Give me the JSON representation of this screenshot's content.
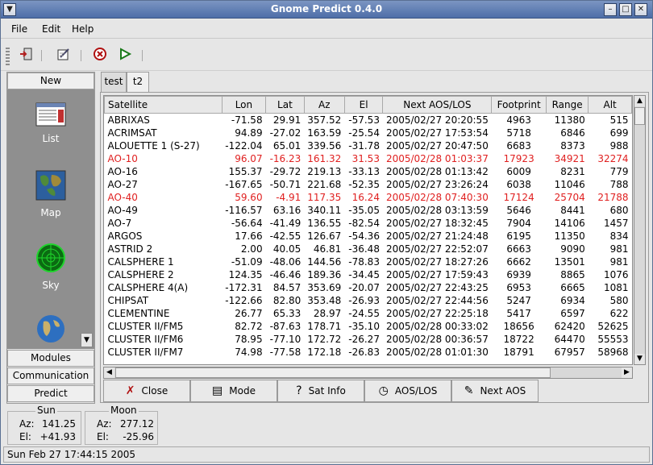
{
  "window": {
    "title": "Gnome Predict 0.4.0"
  },
  "menu": {
    "file": "File",
    "edit": "Edit",
    "help": "Help"
  },
  "shortcut": {
    "group_top": "New",
    "items": [
      {
        "label": "List",
        "icon": "list-icon"
      },
      {
        "label": "Map",
        "icon": "map-icon"
      },
      {
        "label": "Sky",
        "icon": "radar-icon"
      },
      {
        "label": "",
        "icon": "globe-icon"
      }
    ],
    "groups_bottom": [
      "Modules",
      "Communication",
      "Predict"
    ]
  },
  "tabs": [
    "test",
    "t2"
  ],
  "active_tab": "t2",
  "table": {
    "columns": [
      "Satellite",
      "Lon",
      "Lat",
      "Az",
      "El",
      "Next AOS/LOS",
      "Footprint",
      "Range",
      "Alt"
    ],
    "rows": [
      [
        "ABRIXAS",
        "-71.58",
        "29.91",
        "357.52",
        "-57.53",
        "2005/02/27 20:20:55",
        "4963",
        "11380",
        "515"
      ],
      [
        "ACRIMSAT",
        "94.89",
        "-27.02",
        "163.59",
        "-25.54",
        "2005/02/27 17:53:54",
        "5718",
        "6846",
        "699"
      ],
      [
        "ALOUETTE 1 (S-27)",
        "-122.04",
        "65.01",
        "339.56",
        "-31.78",
        "2005/02/27 20:47:50",
        "6683",
        "8373",
        "988"
      ],
      [
        "AO-10",
        "96.07",
        "-16.23",
        "161.32",
        "31.53",
        "2005/02/28 01:03:37",
        "17923",
        "34921",
        "32274"
      ],
      [
        "AO-16",
        "155.37",
        "-29.72",
        "219.13",
        "-33.13",
        "2005/02/28 01:13:42",
        "6009",
        "8231",
        "779"
      ],
      [
        "AO-27",
        "-167.65",
        "-50.71",
        "221.68",
        "-52.35",
        "2005/02/27 23:26:24",
        "6038",
        "11046",
        "788"
      ],
      [
        "AO-40",
        "59.60",
        "-4.91",
        "117.35",
        "16.24",
        "2005/02/28 07:40:30",
        "17124",
        "25704",
        "21788"
      ],
      [
        "AO-49",
        "-116.57",
        "63.16",
        "340.11",
        "-35.05",
        "2005/02/28 03:13:59",
        "5646",
        "8441",
        "680"
      ],
      [
        "AO-7",
        "-56.64",
        "-41.49",
        "136.55",
        "-82.54",
        "2005/02/27 18:32:45",
        "7904",
        "14106",
        "1457"
      ],
      [
        "ARGOS",
        "17.66",
        "-42.55",
        "126.67",
        "-54.36",
        "2005/02/27 21:24:48",
        "6195",
        "11350",
        "834"
      ],
      [
        "ASTRID 2",
        "2.00",
        "40.05",
        "46.81",
        "-36.48",
        "2005/02/27 22:52:07",
        "6663",
        "9090",
        "981"
      ],
      [
        "CALSPHERE 1",
        "-51.09",
        "-48.06",
        "144.56",
        "-78.83",
        "2005/02/27 18:27:26",
        "6662",
        "13501",
        "981"
      ],
      [
        "CALSPHERE 2",
        "124.35",
        "-46.46",
        "189.36",
        "-34.45",
        "2005/02/27 17:59:43",
        "6939",
        "8865",
        "1076"
      ],
      [
        "CALSPHERE 4(A)",
        "-172.31",
        "84.57",
        "353.69",
        "-20.07",
        "2005/02/27 22:43:25",
        "6953",
        "6665",
        "1081"
      ],
      [
        "CHIPSAT",
        "-122.66",
        "82.80",
        "353.48",
        "-26.93",
        "2005/02/27 22:44:56",
        "5247",
        "6934",
        "580"
      ],
      [
        "CLEMENTINE",
        "26.77",
        "65.33",
        "28.97",
        "-24.55",
        "2005/02/27 22:25:18",
        "5417",
        "6597",
        "622"
      ],
      [
        "CLUSTER II/FM5",
        "82.72",
        "-87.63",
        "178.71",
        "-35.10",
        "2005/02/28 00:33:02",
        "18656",
        "62420",
        "52625"
      ],
      [
        "CLUSTER II/FM6",
        "78.95",
        "-77.10",
        "172.72",
        "-26.27",
        "2005/02/28 00:36:57",
        "18722",
        "64470",
        "55553"
      ],
      [
        "CLUSTER II/FM7",
        "74.98",
        "-77.58",
        "172.18",
        "-26.83",
        "2005/02/28 01:01:30",
        "18791",
        "67957",
        "58968"
      ]
    ],
    "highlighted_rows": [
      "AO-10",
      "AO-40"
    ],
    "highlight_color": "#e02020"
  },
  "buttons": [
    {
      "label": "Close",
      "icon": "close-x-icon"
    },
    {
      "label": "Mode",
      "icon": "mode-icon"
    },
    {
      "label": "Sat Info",
      "icon": "help-icon"
    },
    {
      "label": "AOS/LOS",
      "icon": "clock-icon"
    },
    {
      "label": "Next AOS",
      "icon": "notepad-icon"
    }
  ],
  "sun": {
    "label": "Sun",
    "az_label": "Az:",
    "az": "141.25",
    "el_label": "El:",
    "el": "+41.93"
  },
  "moon": {
    "label": "Moon",
    "az_label": "Az:",
    "az": "277.12",
    "el_label": "El:",
    "el": "-25.96"
  },
  "status": "Sun Feb 27 17:44:15 2005"
}
